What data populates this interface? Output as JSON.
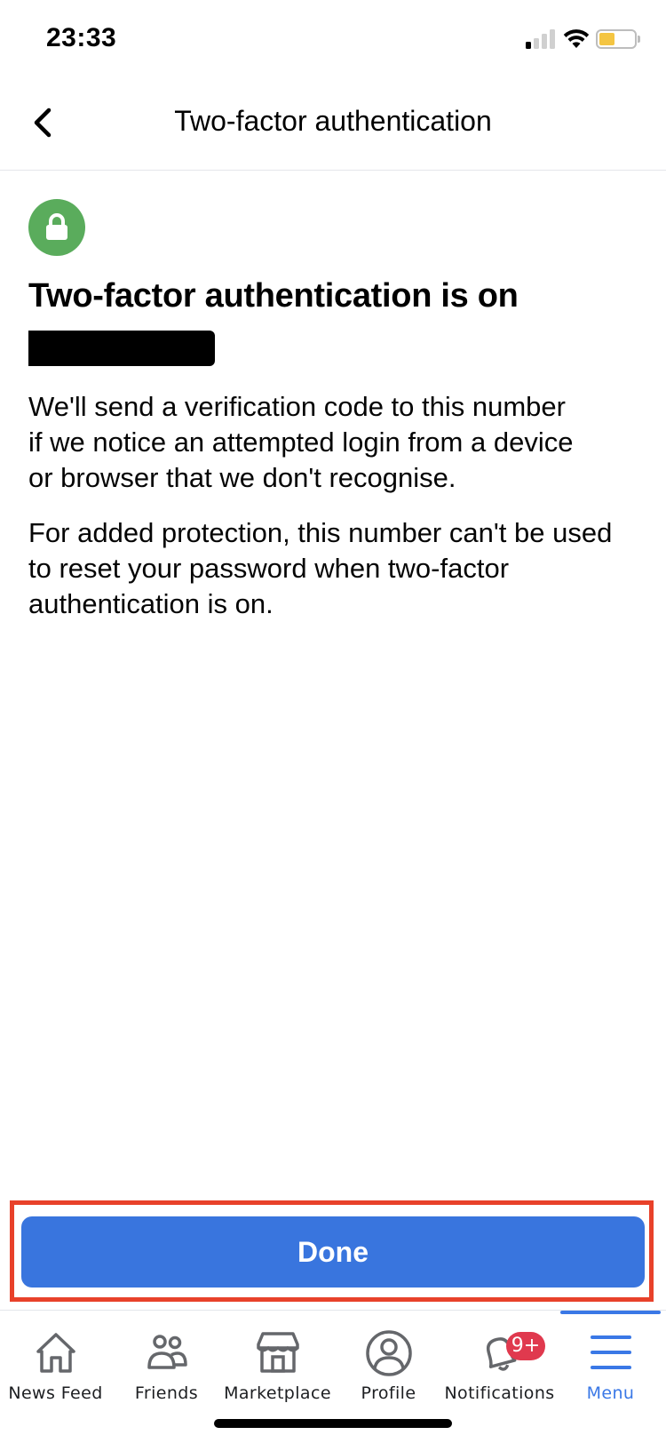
{
  "status_bar": {
    "time": "23:33",
    "signal_bars_active": 1,
    "signal_bars_total": 4,
    "battery_level": 0.2,
    "battery_color": "#f4c542"
  },
  "nav": {
    "back_icon": "chevron-left-icon",
    "title": "Two-factor authentication"
  },
  "content": {
    "status_icon": "lock-icon",
    "status_icon_color": "#5aac5c",
    "headline": "Two-factor authentication is on",
    "phone_number": "",
    "paragraph1": "We'll send a verification code to this number if we notice an attempted login from a device or browser that we don't recognise.",
    "paragraph2": "For added protection, this number can't be used to reset your password when two-factor authentication is on."
  },
  "primary_action": {
    "label": "Done",
    "color": "#3975de",
    "highlighted": true,
    "highlight_color": "#e8412a"
  },
  "tab_bar": {
    "tabs": [
      {
        "label": "News Feed",
        "icon": "home-icon"
      },
      {
        "label": "Friends",
        "icon": "friends-icon"
      },
      {
        "label": "Marketplace",
        "icon": "marketplace-icon"
      },
      {
        "label": "Profile",
        "icon": "profile-icon"
      },
      {
        "label": "Notifications",
        "icon": "bell-icon",
        "badge": "9+"
      },
      {
        "label": "Menu",
        "icon": "menu-icon",
        "active": true
      }
    ],
    "active_color": "#3a78e6",
    "badge_color": "#e0394e"
  }
}
